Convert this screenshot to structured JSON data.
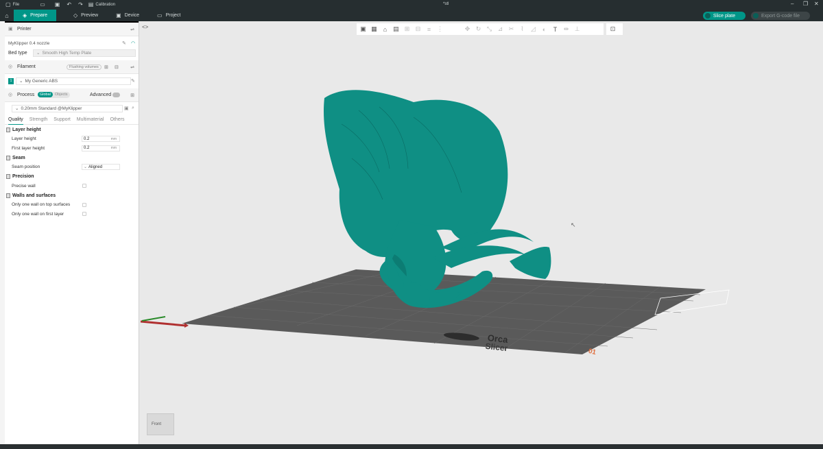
{
  "titlebar": {
    "file_label": "File",
    "calibration_label": "Calibration",
    "window_title": "*stl"
  },
  "tabs": [
    {
      "label": "Prepare",
      "active": true
    },
    {
      "label": "Preview",
      "active": false
    },
    {
      "label": "Device",
      "active": false
    },
    {
      "label": "Project",
      "active": false
    }
  ],
  "actions": {
    "slice_label": "Slice plate",
    "export_label": "Export G-code file"
  },
  "printer": {
    "section_label": "Printer",
    "printer_name": "MyKlipper 0.4 nozzle",
    "bed_type_label": "Bed type",
    "bed_type_value": "Smooth High Temp Plate"
  },
  "filament": {
    "section_label": "Filament",
    "flushing_label": "Flushing volumes",
    "slot_number": "1",
    "filament_name": "My Generic ABS"
  },
  "process": {
    "section_label": "Process",
    "global_label": "Global",
    "objects_label": "Objects",
    "advanced_label": "Advanced",
    "preset": "0.20mm Standard @MyKlipper"
  },
  "settings_tabs": [
    "Quality",
    "Strength",
    "Support",
    "Multimaterial",
    "Others"
  ],
  "groups": {
    "layer_height": {
      "title": "Layer height",
      "layer_height_label": "Layer height",
      "layer_height_value": "0.2",
      "first_layer_label": "First layer height",
      "first_layer_value": "0.2",
      "unit": "mm"
    },
    "seam": {
      "title": "Seam",
      "seam_position_label": "Seam position",
      "seam_position_value": "Aligned"
    },
    "precision": {
      "title": "Precision",
      "precise_wall_label": "Precise wall"
    },
    "walls": {
      "title": "Walls and surfaces",
      "top_wall_label": "Only one wall on top surfaces",
      "first_layer_wall_label": "Only one wall on first layer"
    }
  },
  "viewport": {
    "plate_number": "01",
    "plate_logo_line1": "Orca",
    "plate_logo_line2": "Slicer",
    "navcube_face": "Front"
  },
  "colors": {
    "accent": "#009688",
    "model": "#0f8f84",
    "titlebar": "#262e30",
    "bed": "#5a5a5a"
  }
}
